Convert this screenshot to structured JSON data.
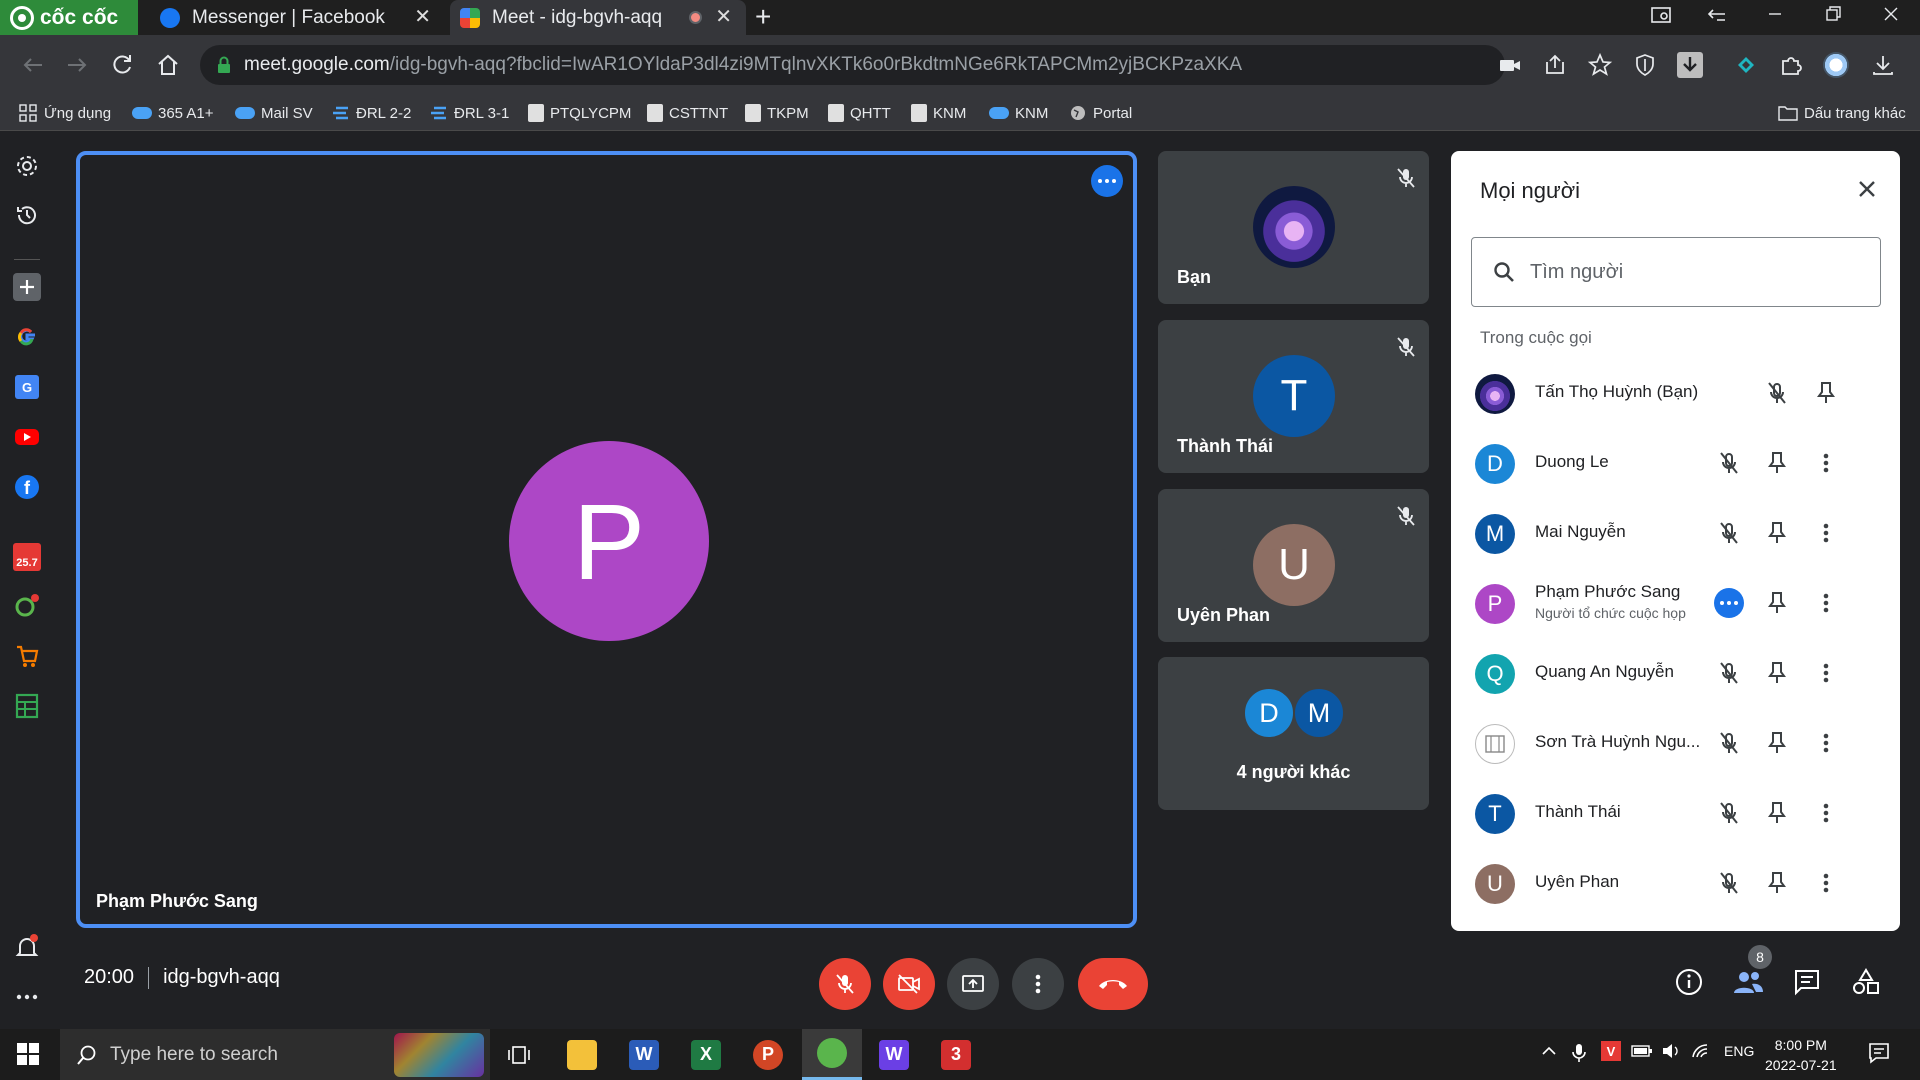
{
  "browser": {
    "brand": "cốc cốc",
    "tabs": [
      {
        "title": "Messenger | Facebook",
        "active": false
      },
      {
        "title": "Meet - idg-bgvh-aqq",
        "active": true
      }
    ],
    "url_host": "meet.google.com",
    "url_path": "/idg-bgvh-aqq?fbclid=IwAR1OYldaP3dl4zi9MTqlnvXKTk6o0rBkdtmNGe6RkTAPCMm2yjBCKPzaXKA",
    "bookmarks": [
      "Ứng dụng",
      "365 A1+",
      "Mail SV",
      "ĐRL 2-2",
      "ĐRL 3-1",
      "PTQLYCPM",
      "CSTTNT",
      "TKPM",
      "QHTT",
      "KNM",
      "KNM",
      "Portal"
    ],
    "other_bookmarks": "Dấu trang khác"
  },
  "sidebar": {
    "badges": {
      "deal": "25.7"
    }
  },
  "meet": {
    "main_tile": {
      "name": "Phạm Phước Sang",
      "initial": "P",
      "color": "#ad47c6"
    },
    "tiles": [
      {
        "name": "Bạn",
        "initial": "",
        "muted": true
      },
      {
        "name": "Thành Thái",
        "initial": "T",
        "color": "#0b57a3",
        "muted": true
      },
      {
        "name": "Uyên Phan",
        "initial": "U",
        "color": "#8d6e63",
        "muted": true
      }
    ],
    "others": {
      "initials": [
        "D",
        "M"
      ],
      "colors": [
        "#1b87d6",
        "#0b57a3"
      ],
      "label": "4 người khác"
    },
    "time": "20:00",
    "meeting_code": "idg-bgvh-aqq",
    "participant_count": "8"
  },
  "people_panel": {
    "title": "Mọi người",
    "search_placeholder": "Tìm người",
    "section": "Trong cuộc gọi",
    "participants": [
      {
        "name": "Tấn Thọ Huỳnh (Bạn)",
        "initial": "",
        "color": "",
        "subtitle": ""
      },
      {
        "name": "Duong Le",
        "initial": "D",
        "color": "#1b87d6",
        "subtitle": ""
      },
      {
        "name": "Mai Nguyễn",
        "initial": "M",
        "color": "#0b57a3",
        "subtitle": ""
      },
      {
        "name": "Phạm Phước Sang",
        "initial": "P",
        "color": "#ad47c6",
        "subtitle": "Người tổ chức cuộc họp"
      },
      {
        "name": "Quang An Nguyễn",
        "initial": "Q",
        "color": "#12a4af",
        "subtitle": ""
      },
      {
        "name": "Sơn Trà Huỳnh Ngu...",
        "initial": "",
        "color": "",
        "subtitle": ""
      },
      {
        "name": "Thành Thái",
        "initial": "T",
        "color": "#0b57a3",
        "subtitle": ""
      },
      {
        "name": "Uyên Phan",
        "initial": "U",
        "color": "#8d6e63",
        "subtitle": ""
      }
    ]
  },
  "taskbar": {
    "search_placeholder": "Type here to search",
    "language": "ENG",
    "time": "8:00 PM",
    "date": "2022-07-21"
  },
  "colors": {
    "accent": "#1a73e8",
    "danger": "#ea4335",
    "tile": "#3c4043"
  }
}
